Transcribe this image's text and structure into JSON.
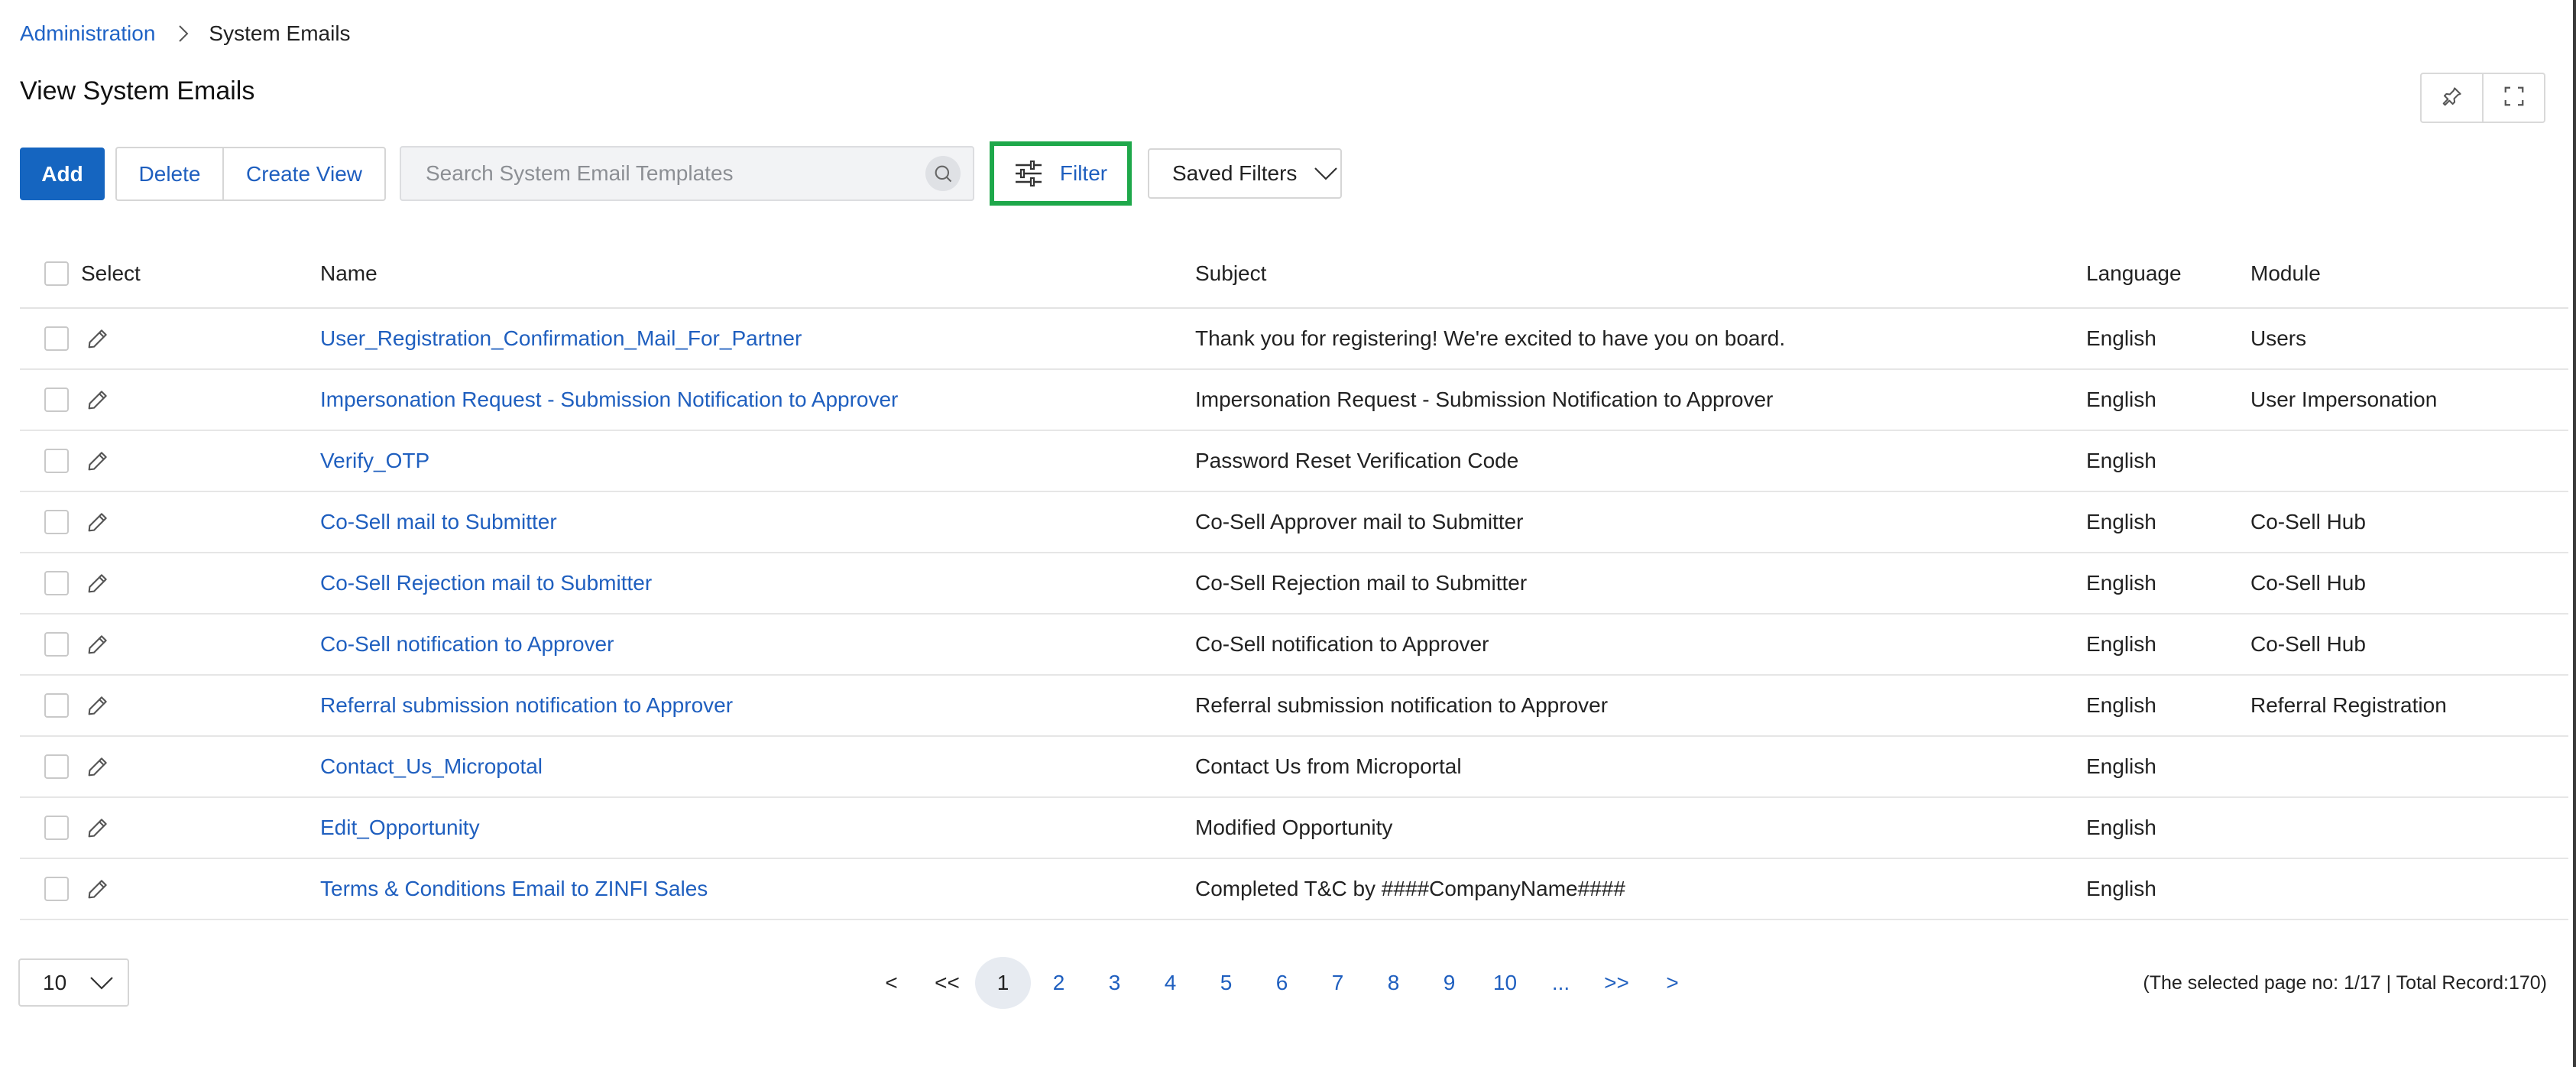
{
  "breadcrumb": {
    "parent": "Administration",
    "current": "System Emails"
  },
  "page": {
    "title": "View System Emails"
  },
  "toolbar": {
    "add_label": "Add",
    "delete_label": "Delete",
    "create_view_label": "Create View",
    "search_placeholder": "Search System Email Templates",
    "search_value": "",
    "filter_label": "Filter",
    "saved_filters_label": "Saved Filters"
  },
  "icons": {
    "pin": "pin-icon",
    "expand": "fullscreen-icon",
    "search": "search-icon",
    "filter": "sliders-icon",
    "edit": "pencil-icon",
    "chevron": "chevron-down-icon",
    "breadcrumb_separator": "chevron-right-icon"
  },
  "colors": {
    "primary": "#1565c0",
    "link": "#1f5fbf",
    "filter_highlight": "#1ea84a"
  },
  "table": {
    "columns": {
      "select": "Select",
      "name": "Name",
      "subject": "Subject",
      "language": "Language",
      "module": "Module"
    },
    "rows": [
      {
        "name": "User_Registration_Confirmation_Mail_For_Partner",
        "subject": "Thank you for registering! We're excited to have you on board.",
        "language": "English",
        "module": "Users"
      },
      {
        "name": "Impersonation Request - Submission Notification to Approver",
        "subject": "Impersonation Request - Submission Notification to Approver",
        "language": "English",
        "module": "User Impersonation"
      },
      {
        "name": "Verify_OTP",
        "subject": "Password Reset Verification Code",
        "language": "English",
        "module": ""
      },
      {
        "name": "Co-Sell mail to Submitter",
        "subject": "Co-Sell Approver mail to Submitter",
        "language": "English",
        "module": "Co-Sell Hub"
      },
      {
        "name": "Co-Sell Rejection mail to Submitter",
        "subject": "Co-Sell Rejection mail to Submitter",
        "language": "English",
        "module": "Co-Sell Hub"
      },
      {
        "name": "Co-Sell notification to Approver",
        "subject": "Co-Sell notification to Approver",
        "language": "English",
        "module": "Co-Sell Hub"
      },
      {
        "name": "Referral submission notification to Approver",
        "subject": "Referral submission notification to Approver",
        "language": "English",
        "module": "Referral Registration"
      },
      {
        "name": "Contact_Us_Micropotal",
        "subject": "Contact Us from Microportal",
        "language": "English",
        "module": ""
      },
      {
        "name": "Edit_Opportunity",
        "subject": "Modified Opportunity",
        "language": "English",
        "module": ""
      },
      {
        "name": "Terms & Conditions Email to ZINFI Sales",
        "subject": "Completed T&C by ####CompanyName####",
        "language": "English",
        "module": ""
      }
    ]
  },
  "pagination": {
    "page_size": "10",
    "prev": "<",
    "first": "<<",
    "pages": [
      "1",
      "2",
      "3",
      "4",
      "5",
      "6",
      "7",
      "8",
      "9",
      "10"
    ],
    "active_page": "1",
    "ellipsis": "...",
    "last": ">>",
    "next": ">",
    "info": "(The selected page no: 1/17 | Total Record:170)"
  }
}
